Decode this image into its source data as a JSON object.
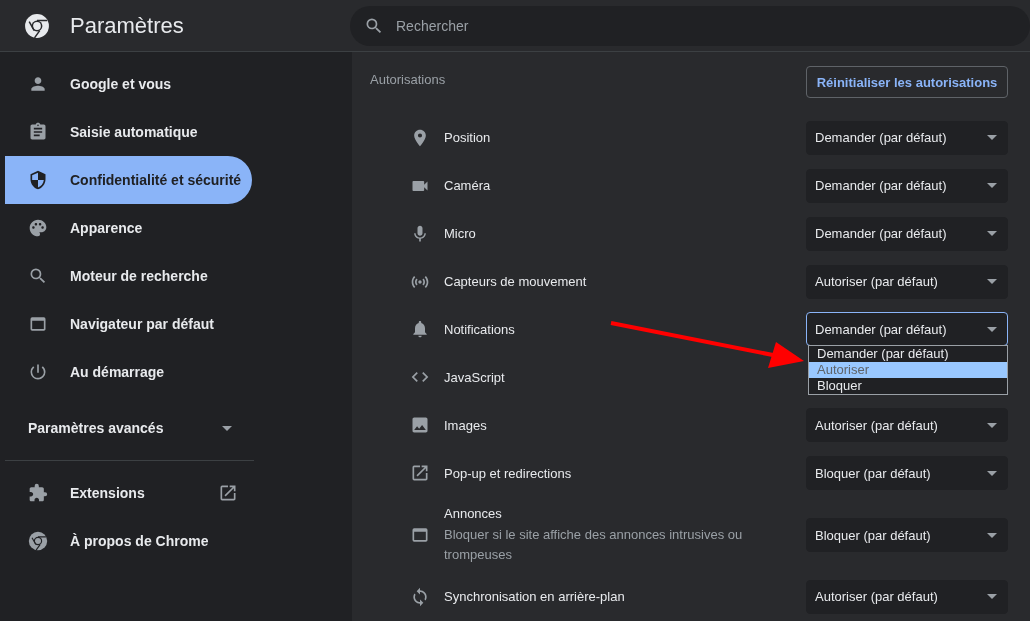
{
  "header": {
    "title": "Paramètres",
    "search": {
      "placeholder": "Rechercher"
    }
  },
  "sidebar": {
    "items": [
      {
        "label": "Google et vous",
        "selected": false
      },
      {
        "label": "Saisie automatique",
        "selected": false
      },
      {
        "label": "Confidentialité et sécurité",
        "selected": true
      },
      {
        "label": "Apparence",
        "selected": false
      },
      {
        "label": "Moteur de recherche",
        "selected": false
      },
      {
        "label": "Navigateur par défaut",
        "selected": false
      },
      {
        "label": "Au démarrage",
        "selected": false
      }
    ],
    "advanced": {
      "label": "Paramètres avancés",
      "expanded": false
    },
    "footer_items": [
      {
        "label": "Extensions",
        "external": true
      },
      {
        "label": "À propos de Chrome",
        "external": false
      }
    ]
  },
  "section": {
    "title": "Autorisations",
    "reset_button": "Réinitialiser les autorisations",
    "rows": [
      {
        "label": "Position",
        "value": "Demander (par défaut)",
        "open": false
      },
      {
        "label": "Caméra",
        "value": "Demander (par défaut)",
        "open": false
      },
      {
        "label": "Micro",
        "value": "Demander (par défaut)",
        "open": false
      },
      {
        "label": "Capteurs de mouvement",
        "value": "Autoriser (par défaut)",
        "open": false
      },
      {
        "label": "Notifications",
        "value": "Demander (par défaut)",
        "open": true,
        "options": [
          {
            "label": "Demander (par défaut)",
            "highlighted": false
          },
          {
            "label": "Autoriser",
            "highlighted": true
          },
          {
            "label": "Bloquer",
            "highlighted": false
          }
        ]
      },
      {
        "label": "JavaScript"
      },
      {
        "label": "Images",
        "value": "Autoriser (par défaut)",
        "open": false
      },
      {
        "label": "Pop-up et redirections",
        "value": "Bloquer (par défaut)",
        "open": false
      },
      {
        "label": "Annonces",
        "description": "Bloquer si le site affiche des annonces intrusives ou trompeuses",
        "value": "Bloquer (par défaut)",
        "open": false
      },
      {
        "label": "Synchronisation en arrière-plan",
        "value": "Autoriser (par défaut)",
        "open": false
      }
    ]
  }
}
